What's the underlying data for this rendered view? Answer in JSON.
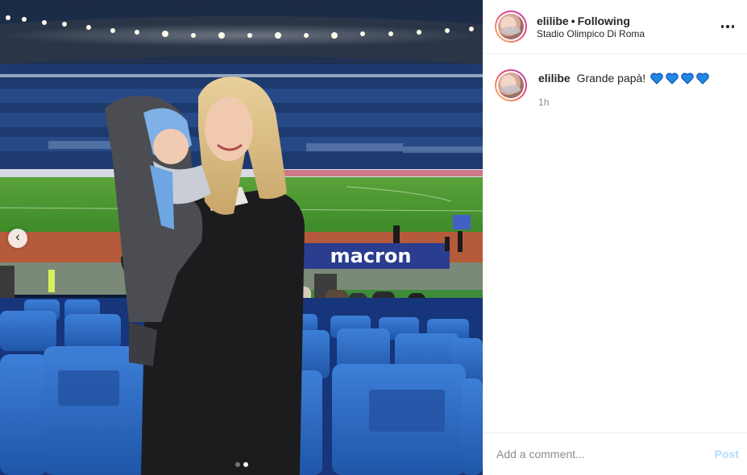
{
  "post": {
    "author": {
      "username": "elilibe",
      "separator": "•",
      "follow_status": "Following",
      "location": "Stadio Olimpico Di Roma"
    },
    "media": {
      "banner_text": "macron",
      "carousel": {
        "total": 2,
        "active_index": 1
      },
      "prev_icon": "chevron-left-icon"
    },
    "caption": {
      "username": "elilibe",
      "text": "Grande papà!",
      "emoji": [
        "blue-heart",
        "blue-heart",
        "blue-heart",
        "blue-heart"
      ],
      "emoji_color": "#1e88e5",
      "time": "1h"
    },
    "add_comment": {
      "placeholder": "Add a comment...",
      "post_label": "Post",
      "post_label_color": "#b3dbff"
    },
    "menu_icon": "more-options-icon"
  }
}
